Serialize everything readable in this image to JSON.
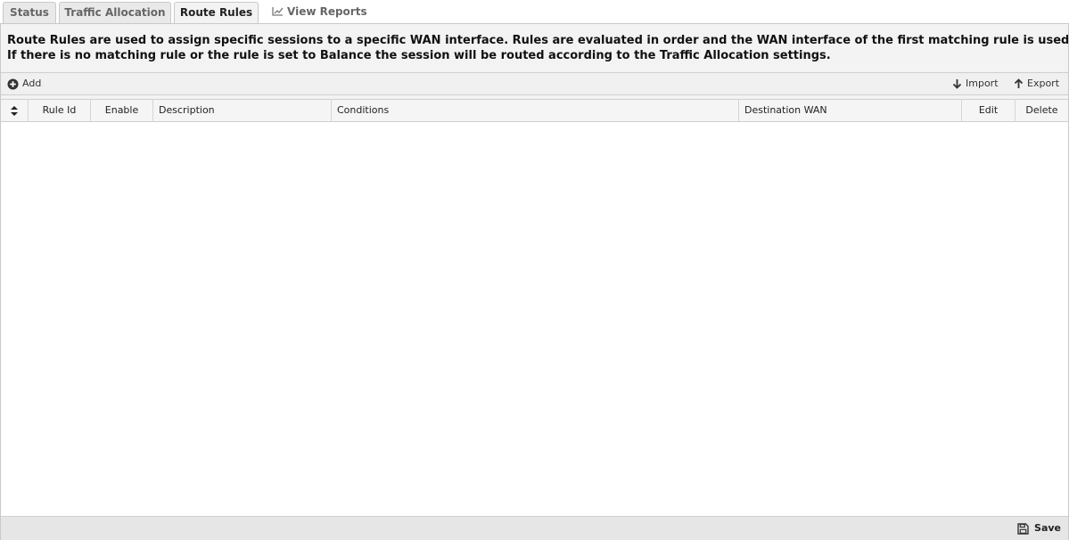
{
  "tabs": [
    {
      "label": "Status"
    },
    {
      "label": "Traffic Allocation"
    },
    {
      "label": "Route Rules",
      "active": true
    },
    {
      "label": "View Reports",
      "icon": "line-chart-icon"
    }
  ],
  "description": {
    "line1": "Route Rules are used to assign specific sessions to a specific WAN interface. Rules are evaluated in order and the WAN interface of the first matching rule is used to rou",
    "line2": "If there is no matching rule or the rule is set to Balance the session will be routed according to the Traffic Allocation settings."
  },
  "toolbar": {
    "add_label": "Add",
    "add_icon": "plus-circle-icon",
    "import_label": "Import",
    "import_icon": "arrow-down-icon",
    "export_label": "Export",
    "export_icon": "arrow-up-icon"
  },
  "grid": {
    "columns": {
      "sort": "",
      "rule_id": "Rule Id",
      "enable": "Enable",
      "description": "Description",
      "conditions": "Conditions",
      "destination_wan": "Destination WAN",
      "edit": "Edit",
      "delete": "Delete"
    },
    "rows": []
  },
  "footer": {
    "save_label": "Save",
    "save_icon": "floppy-disk-icon"
  }
}
